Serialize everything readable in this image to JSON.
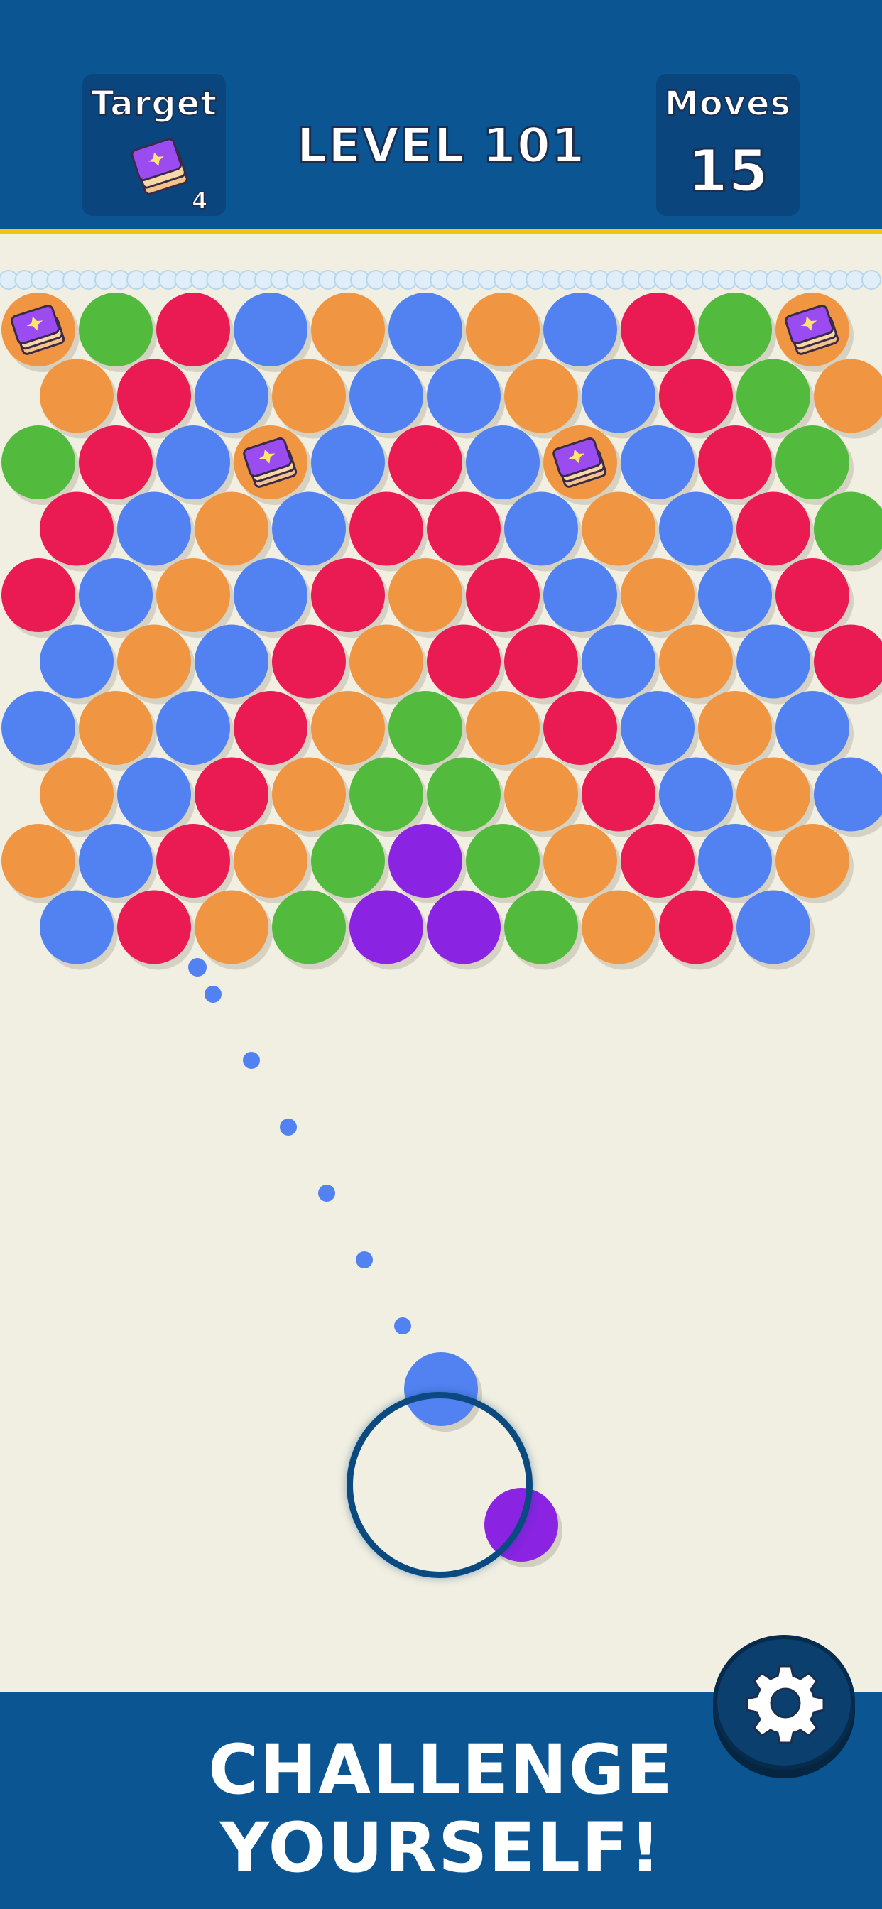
{
  "header": {
    "target_label": "Target",
    "target_count": "4",
    "target_icon": "spell-book-icon",
    "level_title": "LEVEL 101",
    "moves_label": "Moves",
    "moves_value": "15"
  },
  "board": {
    "colors": {
      "B": "#5282f2",
      "R": "#ea1b53",
      "O": "#f09541",
      "G": "#52bb3d",
      "P": "#8a23e2",
      "K": "#f09541"
    },
    "legend": {
      "B": "blue",
      "R": "red",
      "O": "orange",
      "G": "green",
      "P": "purple",
      "K": "book-target"
    },
    "rows": [
      "KGRBOBOBRGK",
      "ORBOBBOBRGO",
      "GRBKBRBKBRG",
      "RBOBRRBOBRG",
      "RBOBRORBOBR",
      "BOBRORRBOBR",
      "BOBROGORBOB",
      "OBROGGORBOB",
      "OBROGPGORBO",
      "BROGPPGORB"
    ]
  },
  "shooter": {
    "current_color": "#5282f2",
    "next_color": "#8a23e2",
    "aim_dot_color": "#5282f2"
  },
  "footer": {
    "line1": "CHALLENGE",
    "line2": "YOURSELF!",
    "settings_icon": "gear-icon"
  }
}
